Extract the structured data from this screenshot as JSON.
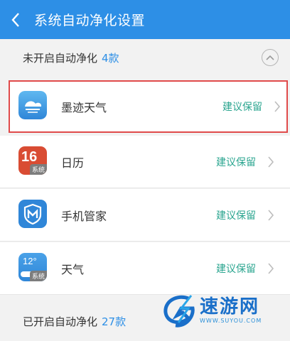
{
  "header": {
    "title": "系统自动净化设置"
  },
  "section_off": {
    "label": "未开启自动净化",
    "count": "4款"
  },
  "apps": [
    {
      "name": "墨迹天气",
      "action": "建议保留",
      "icon": "moji-weather-icon"
    },
    {
      "name": "日历",
      "action": "建议保留",
      "icon": "calendar-icon",
      "badge": "系统",
      "day": "16"
    },
    {
      "name": "手机管家",
      "action": "建议保留",
      "icon": "phone-manager-icon"
    },
    {
      "name": "天气",
      "action": "建议保留",
      "icon": "weather-icon",
      "badge": "系统",
      "temp": "12°"
    }
  ],
  "section_on": {
    "label": "已开启自动净化",
    "count": "27款"
  },
  "watermark": {
    "title": "速游网",
    "url": "WWW.SUYOU.COM"
  },
  "colors": {
    "header": "#2d8fe6",
    "action": "#2aa58f",
    "selection": "#e04a4a"
  }
}
